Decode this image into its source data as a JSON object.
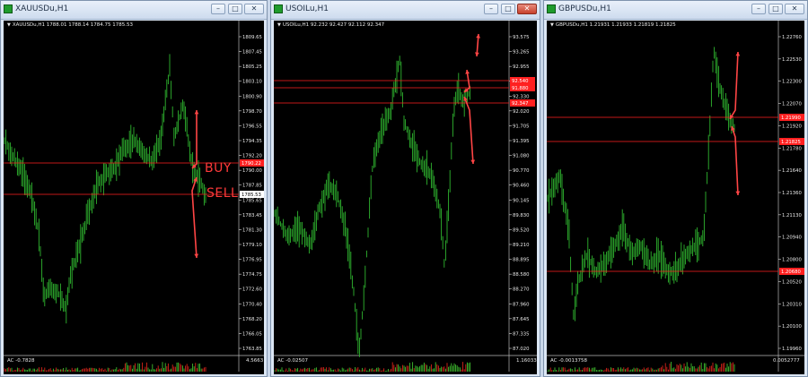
{
  "windows": [
    {
      "title": "XAUUSDu,H1",
      "header": "XAUUSDu,H1  1788.01 1788.14 1784.75 1785.53",
      "indicator_label": "AC -0.7828",
      "indicator_right": "4.5663",
      "buttons": {
        "minimize": "–",
        "maximize": "□",
        "close": "✕"
      },
      "close_active": false,
      "price_ticks": [
        "1809.65",
        "1807.45",
        "1805.25",
        "1803.10",
        "1800.90",
        "1798.70",
        "1796.55",
        "1794.35",
        "1792.20",
        "1790.00",
        "1787.85",
        "1785.65",
        "1783.45",
        "1781.30",
        "1779.10",
        "1776.95",
        "1774.75",
        "1772.60",
        "1770.40",
        "1768.20",
        "1766.05",
        "1763.85"
      ],
      "levels": [
        {
          "label": "1790.22"
        },
        {
          "label": "1785.53"
        }
      ],
      "annotations": {
        "buy": "BUY",
        "sell": "SELL"
      }
    },
    {
      "title": "USOILu,H1",
      "header": "USOILu,H1  92.232 92.427 92.112 92.347",
      "indicator_label": "AC -0.02507",
      "indicator_right": "1.16033",
      "buttons": {
        "minimize": "–",
        "maximize": "□",
        "close": "✕"
      },
      "close_active": true,
      "price_ticks": [
        "93.575",
        "93.265",
        "92.955",
        "92.640",
        "92.330",
        "92.020",
        "91.705",
        "91.395",
        "91.080",
        "90.770",
        "90.460",
        "90.145",
        "89.830",
        "89.520",
        "89.210",
        "88.895",
        "88.580",
        "88.270",
        "87.960",
        "87.645",
        "87.335",
        "87.020"
      ],
      "levels": [
        {
          "label": "92.540"
        },
        {
          "label": "92.347"
        },
        {
          "label": "91.880"
        }
      ]
    },
    {
      "title": "GBPUSDu,H1",
      "header": "GBPUSDu,H1  1.21931 1.21933 1.21819 1.21825",
      "indicator_label": "AC -0.0013758",
      "indicator_right": "0.0052777",
      "buttons": {
        "minimize": "–",
        "maximize": "□",
        "close": "✕"
      },
      "close_active": false,
      "price_ticks": [
        "1.22760",
        "1.22530",
        "1.22300",
        "1.22070",
        "1.21920",
        "1.21780",
        "1.21640",
        "1.21360",
        "1.21130",
        "1.20940",
        "1.20800",
        "1.20520",
        "1.20310",
        "1.20100",
        "1.19960"
      ],
      "levels": [
        {
          "label": "1.21990"
        },
        {
          "label": "1.21825"
        },
        {
          "label": "1.20680"
        }
      ]
    }
  ],
  "colors": {
    "candle": "#2fb52f",
    "level": "#ff2020",
    "arrow": "#ff4545",
    "axis_text": "#e8e8e8",
    "hist_red": "#d8241a",
    "hist_green": "#3fbf2f"
  }
}
